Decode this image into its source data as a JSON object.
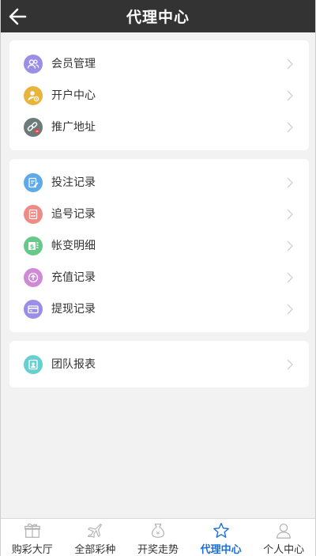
{
  "header": {
    "title": "代理中心",
    "back_icon": "back-arrow-icon"
  },
  "groups": [
    {
      "items": [
        {
          "label": "会员管理",
          "icon": "members-icon",
          "color": "#9b8ee6"
        },
        {
          "label": "开户中心",
          "icon": "open-account-icon",
          "color": "#e8b43c"
        },
        {
          "label": "推广地址",
          "icon": "promo-link-icon",
          "color": "#6c7a7a"
        }
      ]
    },
    {
      "items": [
        {
          "label": "投注记录",
          "icon": "bet-record-icon",
          "color": "#5ea9e8"
        },
        {
          "label": "追号记录",
          "icon": "chase-record-icon",
          "color": "#f08a85"
        },
        {
          "label": "帐变明细",
          "icon": "account-change-icon",
          "color": "#66c98a"
        },
        {
          "label": "充值记录",
          "icon": "recharge-record-icon",
          "color": "#d089d6"
        },
        {
          "label": "提现记录",
          "icon": "withdraw-record-icon",
          "color": "#9b8ee6"
        }
      ]
    },
    {
      "items": [
        {
          "label": "团队报表",
          "icon": "team-report-icon",
          "color": "#66cfd0"
        }
      ]
    }
  ],
  "tabbar": {
    "active_color": "#1a6fd6",
    "tabs": [
      {
        "label": "购彩大厅",
        "icon": "gift-icon",
        "active": false
      },
      {
        "label": "全部彩种",
        "icon": "plane-icon",
        "active": false
      },
      {
        "label": "开奖走势",
        "icon": "money-bag-icon",
        "active": false
      },
      {
        "label": "代理中心",
        "icon": "star-icon",
        "active": true
      },
      {
        "label": "个人中心",
        "icon": "user-icon",
        "active": false
      }
    ]
  }
}
